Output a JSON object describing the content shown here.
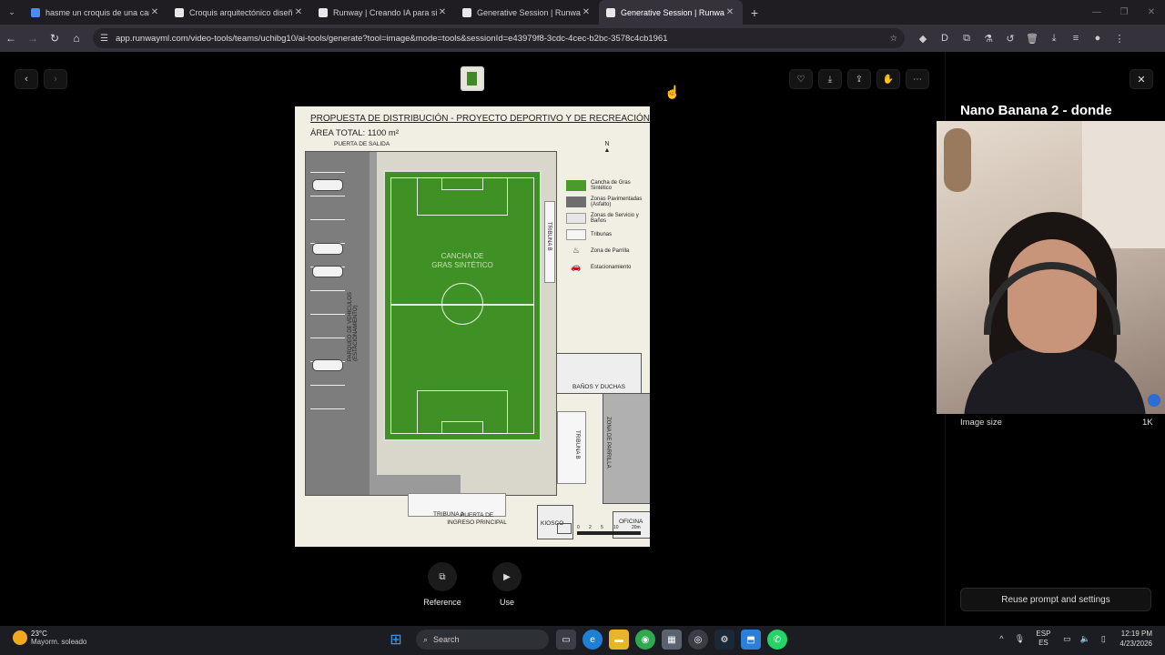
{
  "browser": {
    "tabs": [
      {
        "label": "hasme un croquis de una canch",
        "fav_color": "#4a8cf0",
        "active": false
      },
      {
        "label": "Croquis arquitectónico diseño",
        "fav_color": "#e8e8e8",
        "active": false
      },
      {
        "label": "Runway | Creando IA para simu",
        "fav_color": "#e8e8e8",
        "active": false
      },
      {
        "label": "Generative Session | Runway AI",
        "fav_color": "#e8e8e8",
        "active": false
      },
      {
        "label": "Generative Session | Runway AI",
        "fav_color": "#e8e8e8",
        "active": true
      }
    ],
    "url": "app.runwayml.com/video-tools/teams/uchibg10/ai-tools/generate?tool=image&mode=tools&sessionId=e43979f8-3cdc-4cec-b2bc-3578c4cb1961"
  },
  "image": {
    "title": "PROPUESTA DE DISTRIBUCIÓN - PROYECTO DEPORTIVO Y DE RECREACIÓN",
    "area": "ÁREA TOTAL: 1100 m²",
    "gate_exit": "PUERTA DE SALIDA",
    "field_label_1": "CANCHA DE",
    "field_label_2": "GRAS SINTÉTICO",
    "parking_label": "PARQUEO DE VEHÍCULOS (ESTACIONAMIENTO)",
    "tribuna_b": "TRIBUNA B",
    "tribuna_a": "TRIBUNA A",
    "banos": "BAÑOS Y DUCHAS",
    "parrilla": "ZONA DE PARRILLA",
    "kiosco": "KIOSCO",
    "oficina": "OFICINA",
    "main_gate_1": "PUERTA DE",
    "main_gate_2": "INGRESO PRINCIPAL",
    "north": "N",
    "scale_labels": [
      "0",
      "2",
      "5",
      "10",
      "20m"
    ],
    "legend": [
      {
        "label": "Cancha de Gras Sintético",
        "color": "#4a9a2c"
      },
      {
        "label": "Zonas Pavimentadas (Asfalto)",
        "color": "#6e6e6e"
      },
      {
        "label": "Zonas de Servicio y Baños",
        "color": "#e6e6e6"
      },
      {
        "label": "Tribunas",
        "color": "#f5f5f5"
      },
      {
        "label": "Zona de Parrilla",
        "color": "#f1efe4"
      },
      {
        "label": "Estacionamiento",
        "color": "#f1efe4"
      }
    ]
  },
  "viewer": {
    "reference_label": "Reference",
    "use_label": "Use"
  },
  "panel": {
    "title": "Nano Banana 2 - donde",
    "image_size_label": "Image size",
    "image_size_value": "1K",
    "reuse_label": "Reuse prompt and settings"
  },
  "taskbar": {
    "weather_temp": "23°C",
    "weather_desc": "Mayorm. soleado",
    "search": "Search",
    "lang_1": "ESP",
    "lang_2": "ES",
    "time": "12:19 PM",
    "date": "4/23/2026"
  }
}
